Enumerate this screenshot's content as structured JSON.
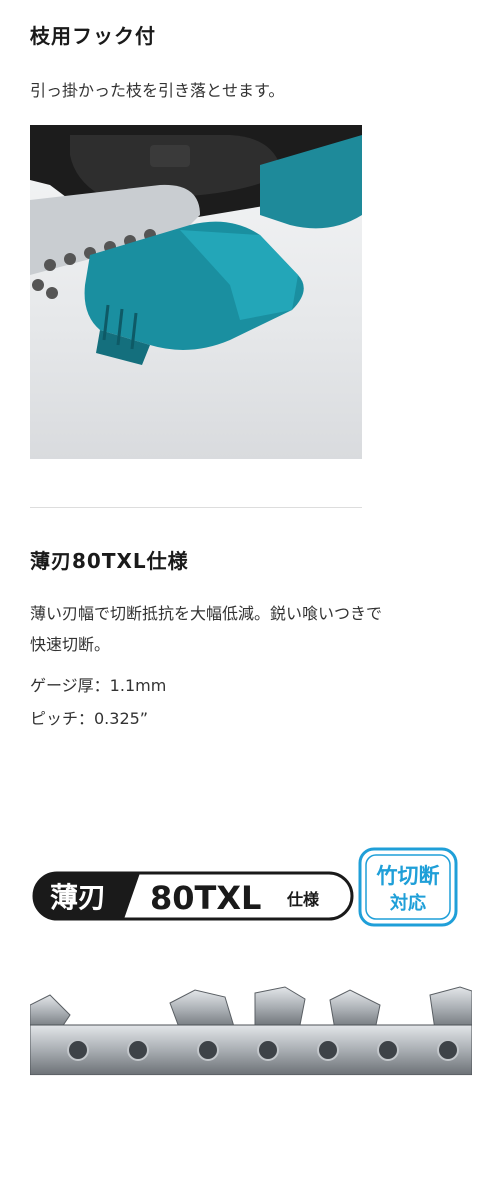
{
  "section1": {
    "heading": "枝用フック付",
    "description": "引っ掛かった枝を引き落とせます。"
  },
  "section2": {
    "heading": "薄刃80TXL仕様",
    "description_line1": "薄い刃幅で切断抵抗を大幅低減。鋭い喰いつきで",
    "description_line2": "快速切断。",
    "gauge": "ゲージ厚：1.1mm",
    "pitch": "ピッチ：0.325”"
  },
  "badge": {
    "left_text": "薄刃",
    "right_text": "80TXL",
    "suffix": "仕様",
    "stamp_line1": "竹切断",
    "stamp_line2": "対応"
  },
  "colors": {
    "accent_teal": "#1a8fa0",
    "stamp_blue": "#1f9fd8",
    "badge_black": "#1a1a1a"
  }
}
